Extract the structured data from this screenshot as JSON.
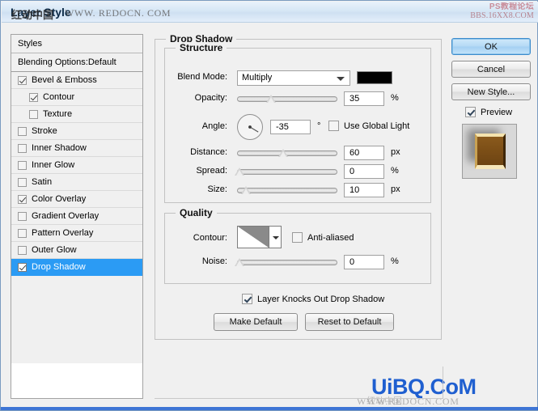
{
  "window": {
    "title": "Layer Style",
    "watermark_title_cn": "红动中国",
    "watermark_title_url": "WWW. REDOCN. COM",
    "watermark_topright_line1": "PS教程论坛",
    "watermark_topright_line2": "BBS.16XX8.COM",
    "watermark_bottom": "UiBQ.CoM",
    "watermark_bottom_sub": "WWW.REDOCN.COM",
    "watermark_bottom_cn": "红动中国"
  },
  "styles_panel": {
    "header": "Styles",
    "blending_options": "Blending Options:Default",
    "items": [
      {
        "label": "Bevel & Emboss",
        "checked": true,
        "indent": false,
        "selected": false
      },
      {
        "label": "Contour",
        "checked": true,
        "indent": true,
        "selected": false
      },
      {
        "label": "Texture",
        "checked": false,
        "indent": true,
        "selected": false
      },
      {
        "label": "Stroke",
        "checked": false,
        "indent": false,
        "selected": false
      },
      {
        "label": "Inner Shadow",
        "checked": false,
        "indent": false,
        "selected": false
      },
      {
        "label": "Inner Glow",
        "checked": false,
        "indent": false,
        "selected": false
      },
      {
        "label": "Satin",
        "checked": false,
        "indent": false,
        "selected": false
      },
      {
        "label": "Color Overlay",
        "checked": true,
        "indent": false,
        "selected": false
      },
      {
        "label": "Gradient Overlay",
        "checked": false,
        "indent": false,
        "selected": false
      },
      {
        "label": "Pattern Overlay",
        "checked": false,
        "indent": false,
        "selected": false
      },
      {
        "label": "Outer Glow",
        "checked": false,
        "indent": false,
        "selected": false
      },
      {
        "label": "Drop Shadow",
        "checked": true,
        "indent": false,
        "selected": true
      }
    ]
  },
  "drop_shadow": {
    "group_title": "Drop Shadow",
    "structure": {
      "title": "Structure",
      "blend_mode_label": "Blend Mode:",
      "blend_mode_value": "Multiply",
      "shadow_color": "#000000",
      "opacity_label": "Opacity:",
      "opacity_value": "35",
      "opacity_unit": "%",
      "angle_label": "Angle:",
      "angle_value": "-35",
      "angle_unit": "°",
      "use_global_light_label": "Use Global Light",
      "use_global_light_checked": false,
      "distance_label": "Distance:",
      "distance_value": "60",
      "distance_unit": "px",
      "spread_label": "Spread:",
      "spread_value": "0",
      "spread_unit": "%",
      "size_label": "Size:",
      "size_value": "10",
      "size_unit": "px"
    },
    "quality": {
      "title": "Quality",
      "contour_label": "Contour:",
      "anti_aliased_label": "Anti-aliased",
      "anti_aliased_checked": false,
      "noise_label": "Noise:",
      "noise_value": "0",
      "noise_unit": "%"
    },
    "layer_knocks_out_label": "Layer Knocks Out Drop Shadow",
    "layer_knocks_out_checked": true,
    "make_default_label": "Make Default",
    "reset_to_default_label": "Reset to Default"
  },
  "actions": {
    "ok_label": "OK",
    "cancel_label": "Cancel",
    "new_style_label": "New Style...",
    "preview_label": "Preview",
    "preview_checked": true
  },
  "colors": {
    "selection_blue": "#2b9bf4",
    "titlebar_blue": "#d6e6f5",
    "accent_watermark": "#1f5fd0"
  }
}
